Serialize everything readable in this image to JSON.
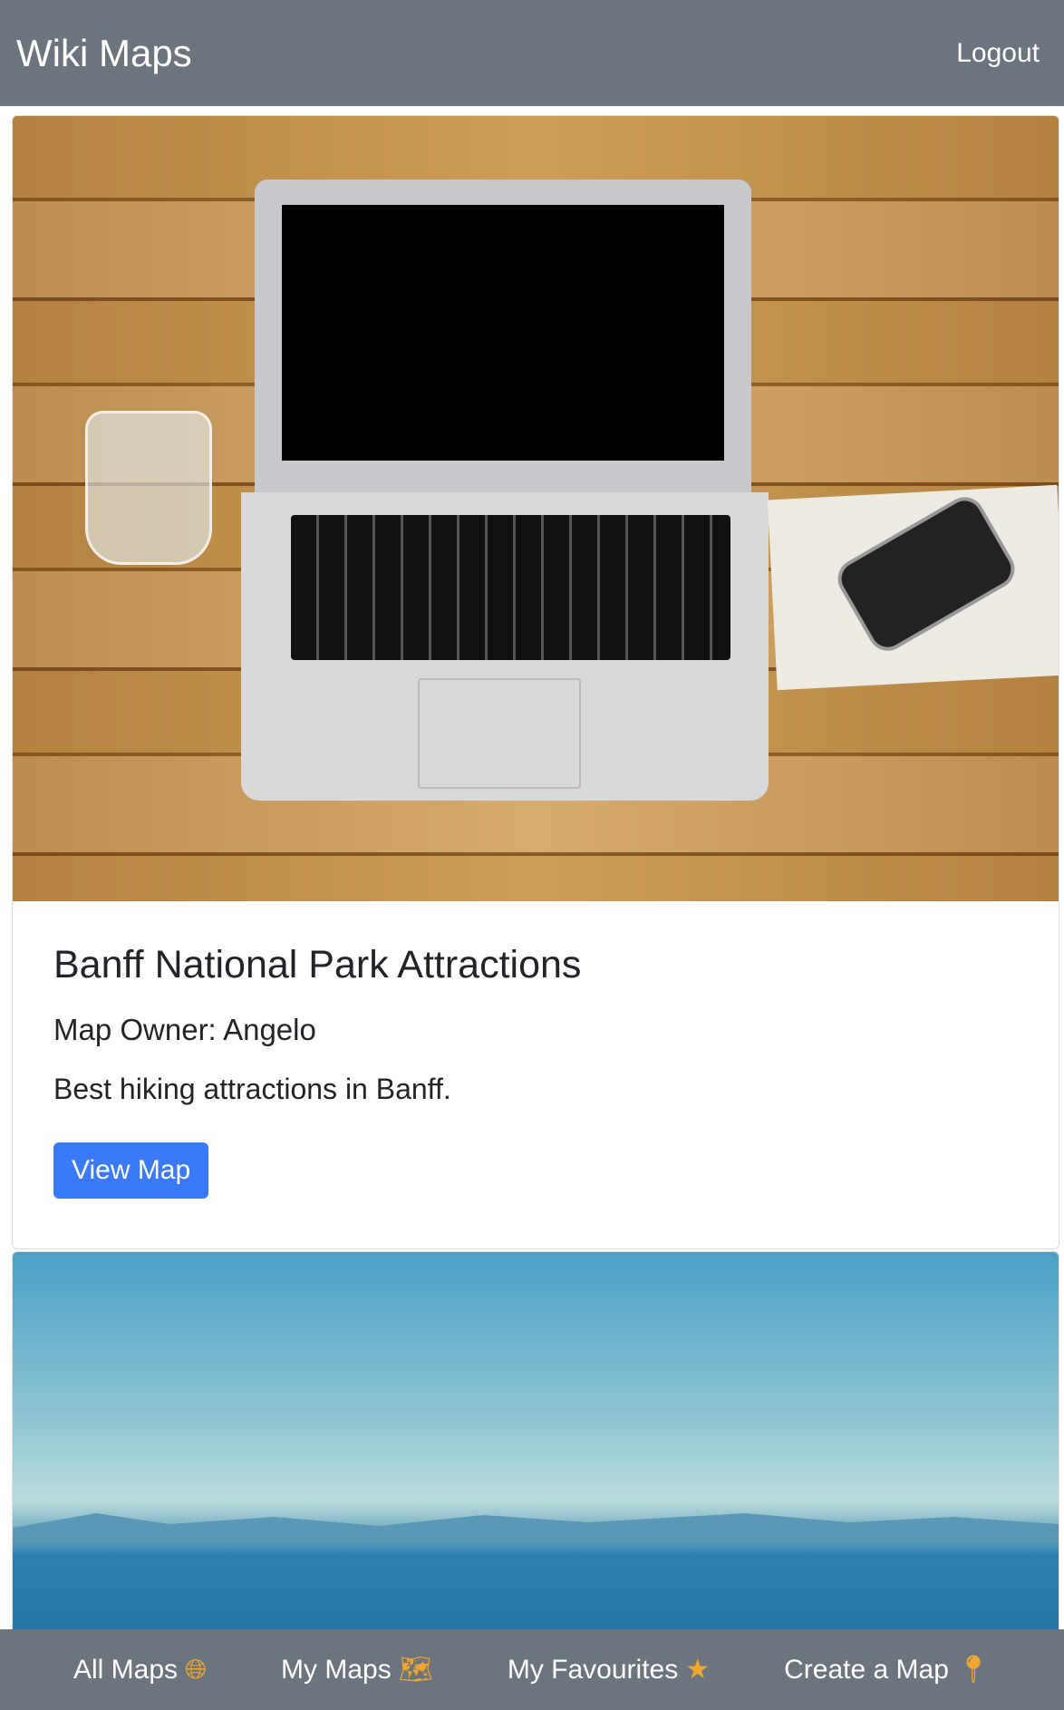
{
  "header": {
    "title": "Wiki Maps",
    "logout": "Logout"
  },
  "cards": [
    {
      "title": "Banff National Park Attractions",
      "owner": "Map Owner: Angelo",
      "description": "Best hiking attractions in Banff.",
      "button": "View Map",
      "image": "laptop on wooden desk"
    },
    {
      "image": "lake with mountains"
    }
  ],
  "nav": [
    {
      "label": "All Maps",
      "icon": "globe-icon"
    },
    {
      "label": "My Maps",
      "icon": "map-marked-icon"
    },
    {
      "label": "My Favourites",
      "icon": "star-icon"
    },
    {
      "label": "Create a Map",
      "icon": "map-pin-icon"
    }
  ],
  "colors": {
    "navbar": "#6c757d",
    "button": "#3b7af7",
    "icon": "#f0a732"
  }
}
